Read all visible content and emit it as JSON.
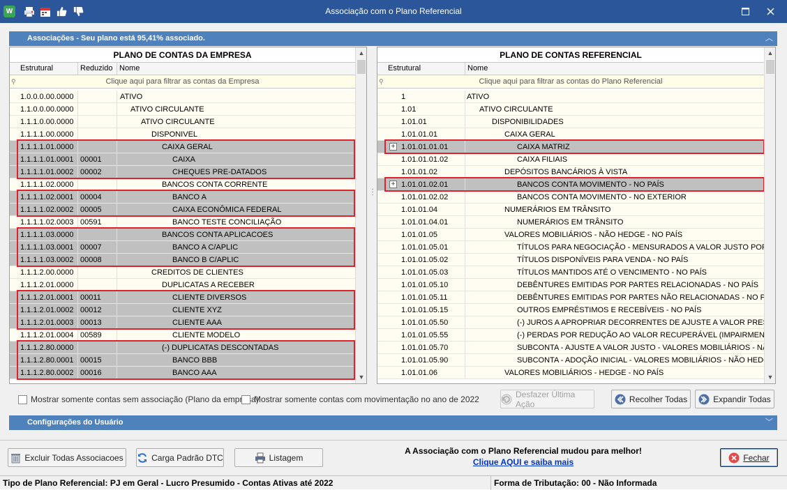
{
  "window": {
    "title": "Associação com o Plano Referencial"
  },
  "associations": {
    "header": "Associações - Seu plano está 95,41% associado."
  },
  "left": {
    "title": "PLANO DE CONTAS DA EMPRESA",
    "cols": [
      "Estrutural",
      "Reduzido",
      "Nome"
    ],
    "filter": "Clique aqui para filtrar as contas da Empresa",
    "rows": [
      {
        "e": "1.0.0.0.00.0000",
        "r": "",
        "n": "ATIVO",
        "lvl": 0
      },
      {
        "e": "1.1.0.0.00.0000",
        "r": "",
        "n": "ATIVO CIRCULANTE",
        "lvl": 1
      },
      {
        "e": "1.1.1.0.00.0000",
        "r": "",
        "n": "ATIVO CIRCULANTE",
        "lvl": 2
      },
      {
        "e": "1.1.1.1.00.0000",
        "r": "",
        "n": "DISPONIVEL",
        "lvl": 3
      },
      {
        "e": "1.1.1.1.01.0000",
        "r": "",
        "n": "CAIXA GERAL",
        "lvl": 4,
        "sel": true
      },
      {
        "e": "1.1.1.1.01.0001",
        "r": "00001",
        "n": "CAIXA",
        "lvl": 5,
        "sel": true
      },
      {
        "e": "1.1.1.1.01.0002",
        "r": "00002",
        "n": "CHEQUES PRE-DATADOS",
        "lvl": 5,
        "sel": true
      },
      {
        "e": "1.1.1.1.02.0000",
        "r": "",
        "n": "BANCOS CONTA CORRENTE",
        "lvl": 4
      },
      {
        "e": "1.1.1.1.02.0001",
        "r": "00004",
        "n": "BANCO A",
        "lvl": 5,
        "sel": true
      },
      {
        "e": "1.1.1.1.02.0002",
        "r": "00005",
        "n": "CAIXA ECONÔMICA FEDERAL",
        "lvl": 5,
        "sel": true
      },
      {
        "e": "1.1.1.1.02.0003",
        "r": "00591",
        "n": "BANCO TESTE CONCILIAÇÃO",
        "lvl": 5
      },
      {
        "e": "1.1.1.1.03.0000",
        "r": "",
        "n": "BANCOS CONTA APLICACOES",
        "lvl": 4,
        "sel": true
      },
      {
        "e": "1.1.1.1.03.0001",
        "r": "00007",
        "n": "BANCO A C/APLIC",
        "lvl": 5,
        "sel": true
      },
      {
        "e": "1.1.1.1.03.0002",
        "r": "00008",
        "n": "BANCO B C/APLIC",
        "lvl": 5,
        "sel": true
      },
      {
        "e": "1.1.1.2.00.0000",
        "r": "",
        "n": "CREDITOS DE CLIENTES",
        "lvl": 3
      },
      {
        "e": "1.1.1.2.01.0000",
        "r": "",
        "n": "DUPLICATAS A RECEBER",
        "lvl": 4
      },
      {
        "e": "1.1.1.2.01.0001",
        "r": "00011",
        "n": "CLIENTE DIVERSOS",
        "lvl": 5,
        "sel": true
      },
      {
        "e": "1.1.1.2.01.0002",
        "r": "00012",
        "n": "CLIENTE XYZ",
        "lvl": 5,
        "sel": true
      },
      {
        "e": "1.1.1.2.01.0003",
        "r": "00013",
        "n": "CLIENTE AAA",
        "lvl": 5,
        "sel": true
      },
      {
        "e": "1.1.1.2.01.0004",
        "r": "00589",
        "n": "CLIENTE MODELO",
        "lvl": 5
      },
      {
        "e": "1.1.1.2.80.0000",
        "r": "",
        "n": "(-) DUPLICATAS DESCONTADAS",
        "lvl": 4,
        "sel": true
      },
      {
        "e": "1.1.1.2.80.0001",
        "r": "00015",
        "n": "BANCO BBB",
        "lvl": 5,
        "sel": true
      },
      {
        "e": "1.1.1.2.80.0002",
        "r": "00016",
        "n": "BANCO AAA",
        "lvl": 5,
        "sel": true
      }
    ]
  },
  "right": {
    "title": "PLANO DE CONTAS REFERENCIAL",
    "cols": [
      "Estrutural",
      "Nome"
    ],
    "filter": "Clique aqui para filtrar as contas do Plano Referencial",
    "rows": [
      {
        "e": "1",
        "n": "ATIVO",
        "lvl": 0
      },
      {
        "e": "1.01",
        "n": "ATIVO CIRCULANTE",
        "lvl": 1
      },
      {
        "e": "1.01.01",
        "n": "DISPONIBILIDADES",
        "lvl": 2
      },
      {
        "e": "1.01.01.01",
        "n": "CAIXA GERAL",
        "lvl": 3
      },
      {
        "e": "1.01.01.01.01",
        "n": "CAIXA MATRIZ",
        "lvl": 4,
        "sel": true,
        "plus": true
      },
      {
        "e": "1.01.01.01.02",
        "n": "CAIXA FILIAIS",
        "lvl": 4
      },
      {
        "e": "1.01.01.02",
        "n": "DEPÓSITOS BANCÁRIOS À VISTA",
        "lvl": 3
      },
      {
        "e": "1.01.01.02.01",
        "n": "BANCOS CONTA MOVIMENTO - NO PAÍS",
        "lvl": 4,
        "sel": true,
        "plus": true
      },
      {
        "e": "1.01.01.02.02",
        "n": "BANCOS CONTA MOVIMENTO - NO EXTERIOR",
        "lvl": 4
      },
      {
        "e": "1.01.01.04",
        "n": "NUMERÁRIOS EM TRÂNSITO",
        "lvl": 3
      },
      {
        "e": "1.01.01.04.01",
        "n": "NUMERÁRIOS EM TRÂNSITO",
        "lvl": 4
      },
      {
        "e": "1.01.01.05",
        "n": "VALORES MOBILIÁRIOS  - NÃO HEDGE - NO PAÍS",
        "lvl": 3
      },
      {
        "e": "1.01.01.05.01",
        "n": "TÍTULOS PARA NEGOCIAÇÃO - MENSURADOS A VALOR JUSTO POR MEIO",
        "lvl": 4
      },
      {
        "e": "1.01.01.05.02",
        "n": "TÍTULOS DISPONÍVEIS PARA VENDA - NO PAÍS",
        "lvl": 4
      },
      {
        "e": "1.01.01.05.03",
        "n": "TÍTULOS MANTIDOS ATÉ O VENCIMENTO - NO PAÍS",
        "lvl": 4
      },
      {
        "e": "1.01.01.05.10",
        "n": "DEBÊNTURES EMITIDAS POR PARTES RELACIONADAS - NO PAÍS",
        "lvl": 4
      },
      {
        "e": "1.01.01.05.11",
        "n": "DEBÊNTURES EMITIDAS POR PARTES NÃO RELACIONADAS - NO PAÍS",
        "lvl": 4
      },
      {
        "e": "1.01.01.05.15",
        "n": "OUTROS EMPRÉSTIMOS E RECEBÍVEIS - NO PAÍS",
        "lvl": 4
      },
      {
        "e": "1.01.01.05.50",
        "n": "(-) JUROS A APROPRIAR DECORRENTES DE AJUSTE A VALOR PRESENTE",
        "lvl": 4
      },
      {
        "e": "1.01.01.05.55",
        "n": "(-) PERDAS  POR REDUÇÃO AO VALOR RECUPERÁVEL (IMPAIRMENT)- VA",
        "lvl": 4
      },
      {
        "e": "1.01.01.05.70",
        "n": "SUBCONTA - AJUSTE A VALOR JUSTO - VALORES MOBILIÁRIOS - NÃO HE",
        "lvl": 4
      },
      {
        "e": "1.01.01.05.90",
        "n": "SUBCONTA - ADOÇÃO INICIAL -  VALORES MOBILIÁRIOS - NÃO HEDGE -",
        "lvl": 4
      },
      {
        "e": "1.01.01.06",
        "n": "VALORES MOBILIÁRIOS  - HEDGE - NO PAÍS",
        "lvl": 3
      }
    ]
  },
  "options": {
    "chk1": "Mostrar somente contas sem associação (Plano da empresa)",
    "chk2": "Mostrar somente contas com movimentação no ano de 2022",
    "undo": "Desfazer Última Ação",
    "collapse": "Recolher Todas",
    "expand": "Expandir Todas"
  },
  "userConfig": {
    "header": "Configurações do Usuário"
  },
  "bottom": {
    "excluir": "Excluir Todas Associacoes",
    "carga": "Carga Padrão DTC",
    "listagem": "Listagem",
    "promo": "A Associação com o Plano Referencial mudou para melhor!",
    "promoLink": "Clique AQUI e saiba mais",
    "fechar": "Fechar"
  },
  "status": {
    "left": "Tipo de Plano Referencial: PJ em Geral - Lucro Presumido - Contas Ativas até 2022",
    "right": "Forma de Tributação: 00 - Não Informada"
  },
  "colors": {
    "accent": "#2b579a",
    "section": "#4f81bd",
    "highlight": "#e0202a",
    "selected": "#c0c0c0"
  }
}
